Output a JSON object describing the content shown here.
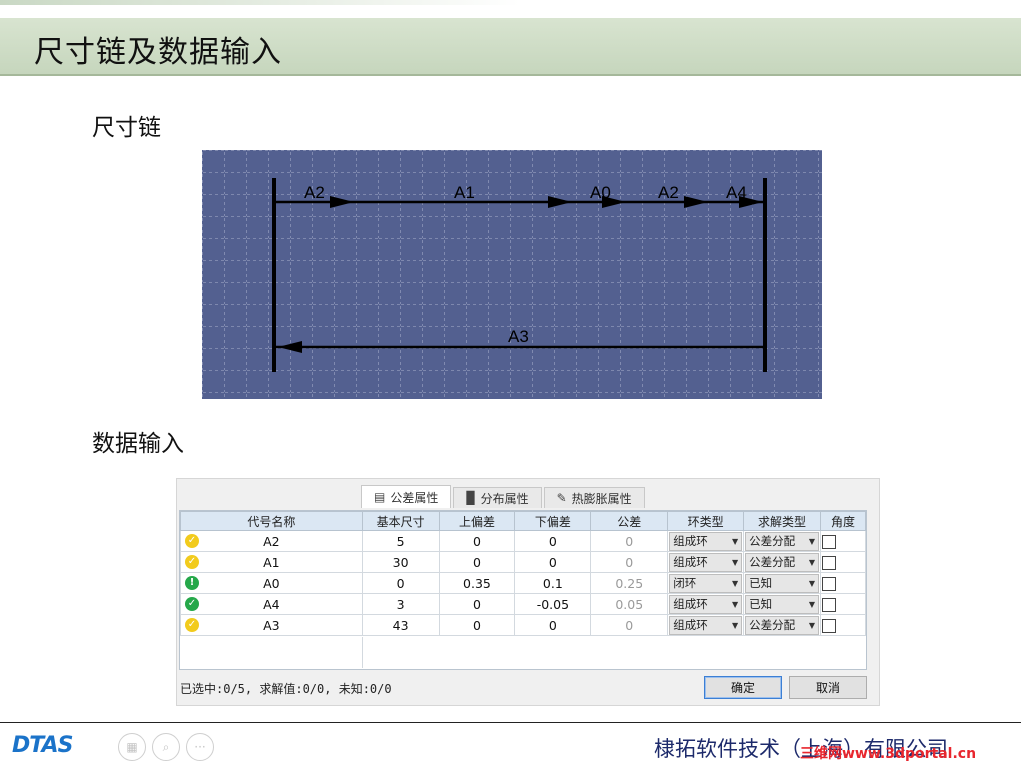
{
  "page": {
    "title": "尺寸链及数据输入",
    "section_chain": "尺寸链",
    "section_data": "数据输入"
  },
  "diagram": {
    "top_labels": [
      "A2",
      "A1",
      "A0",
      "A2",
      "A4"
    ],
    "bottom_label": "A3",
    "colors": {
      "background": "#536090",
      "grid": "#b8c0d8",
      "line": "#000000"
    }
  },
  "panel": {
    "tabs": [
      {
        "label": "公差属性",
        "icon": "ruler-icon",
        "active": true
      },
      {
        "label": "分布属性",
        "icon": "histogram-icon",
        "active": false
      },
      {
        "label": "热膨胀属性",
        "icon": "pencil-icon",
        "active": false
      }
    ],
    "columns": [
      "代号名称",
      "基本尺寸",
      "上偏差",
      "下偏差",
      "公差",
      "环类型",
      "求解类型",
      "角度"
    ],
    "rows": [
      {
        "status": "yellow",
        "status_icon": "check-circle-icon",
        "name": "A2",
        "basic": "5",
        "upper": "0",
        "lower": "0",
        "tol": "0",
        "ring": "组成环",
        "solve": "公差分配"
      },
      {
        "status": "yellow",
        "status_icon": "check-circle-icon",
        "name": "A1",
        "basic": "30",
        "upper": "0",
        "lower": "0",
        "tol": "0",
        "ring": "组成环",
        "solve": "公差分配"
      },
      {
        "status": "green",
        "status_icon": "exclamation-circle-icon",
        "name": "A0",
        "basic": "0",
        "upper": "0.35",
        "lower": "0.1",
        "tol": "0.25",
        "ring": "闭环",
        "solve": "已知"
      },
      {
        "status": "green",
        "status_icon": "check-circle-icon",
        "name": "A4",
        "basic": "3",
        "upper": "0",
        "lower": "-0.05",
        "tol": "0.05",
        "ring": "组成环",
        "solve": "已知"
      },
      {
        "status": "yellow",
        "status_icon": "check-circle-icon",
        "name": "A3",
        "basic": "43",
        "upper": "0",
        "lower": "0",
        "tol": "0",
        "ring": "组成环",
        "solve": "公差分配"
      }
    ],
    "status_text": "已选中:0/5, 求解值:0/0, 未知:0/0",
    "confirm_label": "确定",
    "cancel_label": "取消"
  },
  "footer": {
    "logo": "DTAS",
    "company": "棣拓软件技术（上海）有限公司",
    "watermark": "三维网www.3dportal.cn",
    "nav_icons": [
      "grid-icon",
      "zoom-icon",
      "more-icon"
    ]
  }
}
